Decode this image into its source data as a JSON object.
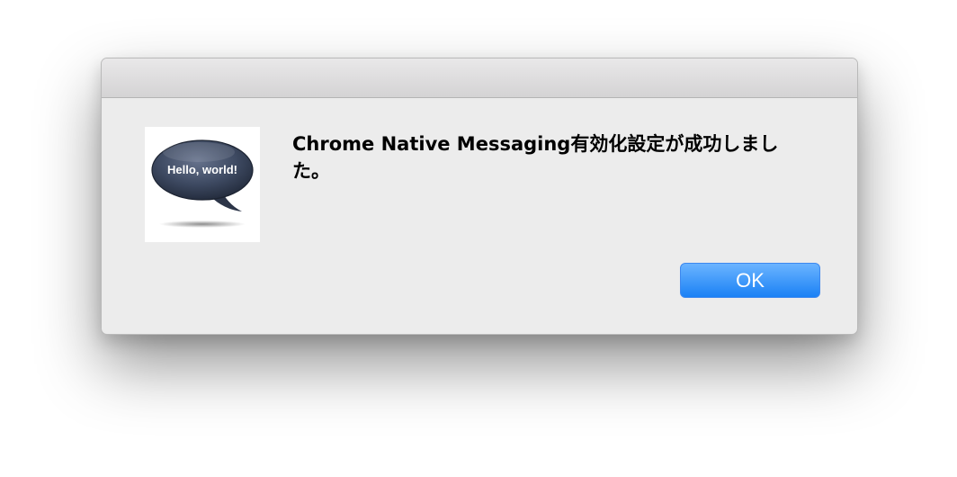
{
  "dialog": {
    "icon": {
      "name": "hello-world-speech-bubble-icon",
      "text": "Hello, world!"
    },
    "message": "Chrome Native Messaging有効化設定が成功しました。",
    "ok_label": "OK"
  },
  "colors": {
    "dialog_background": "#ececec",
    "button_top": "#6bb4ff",
    "button_bottom": "#1a81f5",
    "bubble": "#3f4b63"
  }
}
